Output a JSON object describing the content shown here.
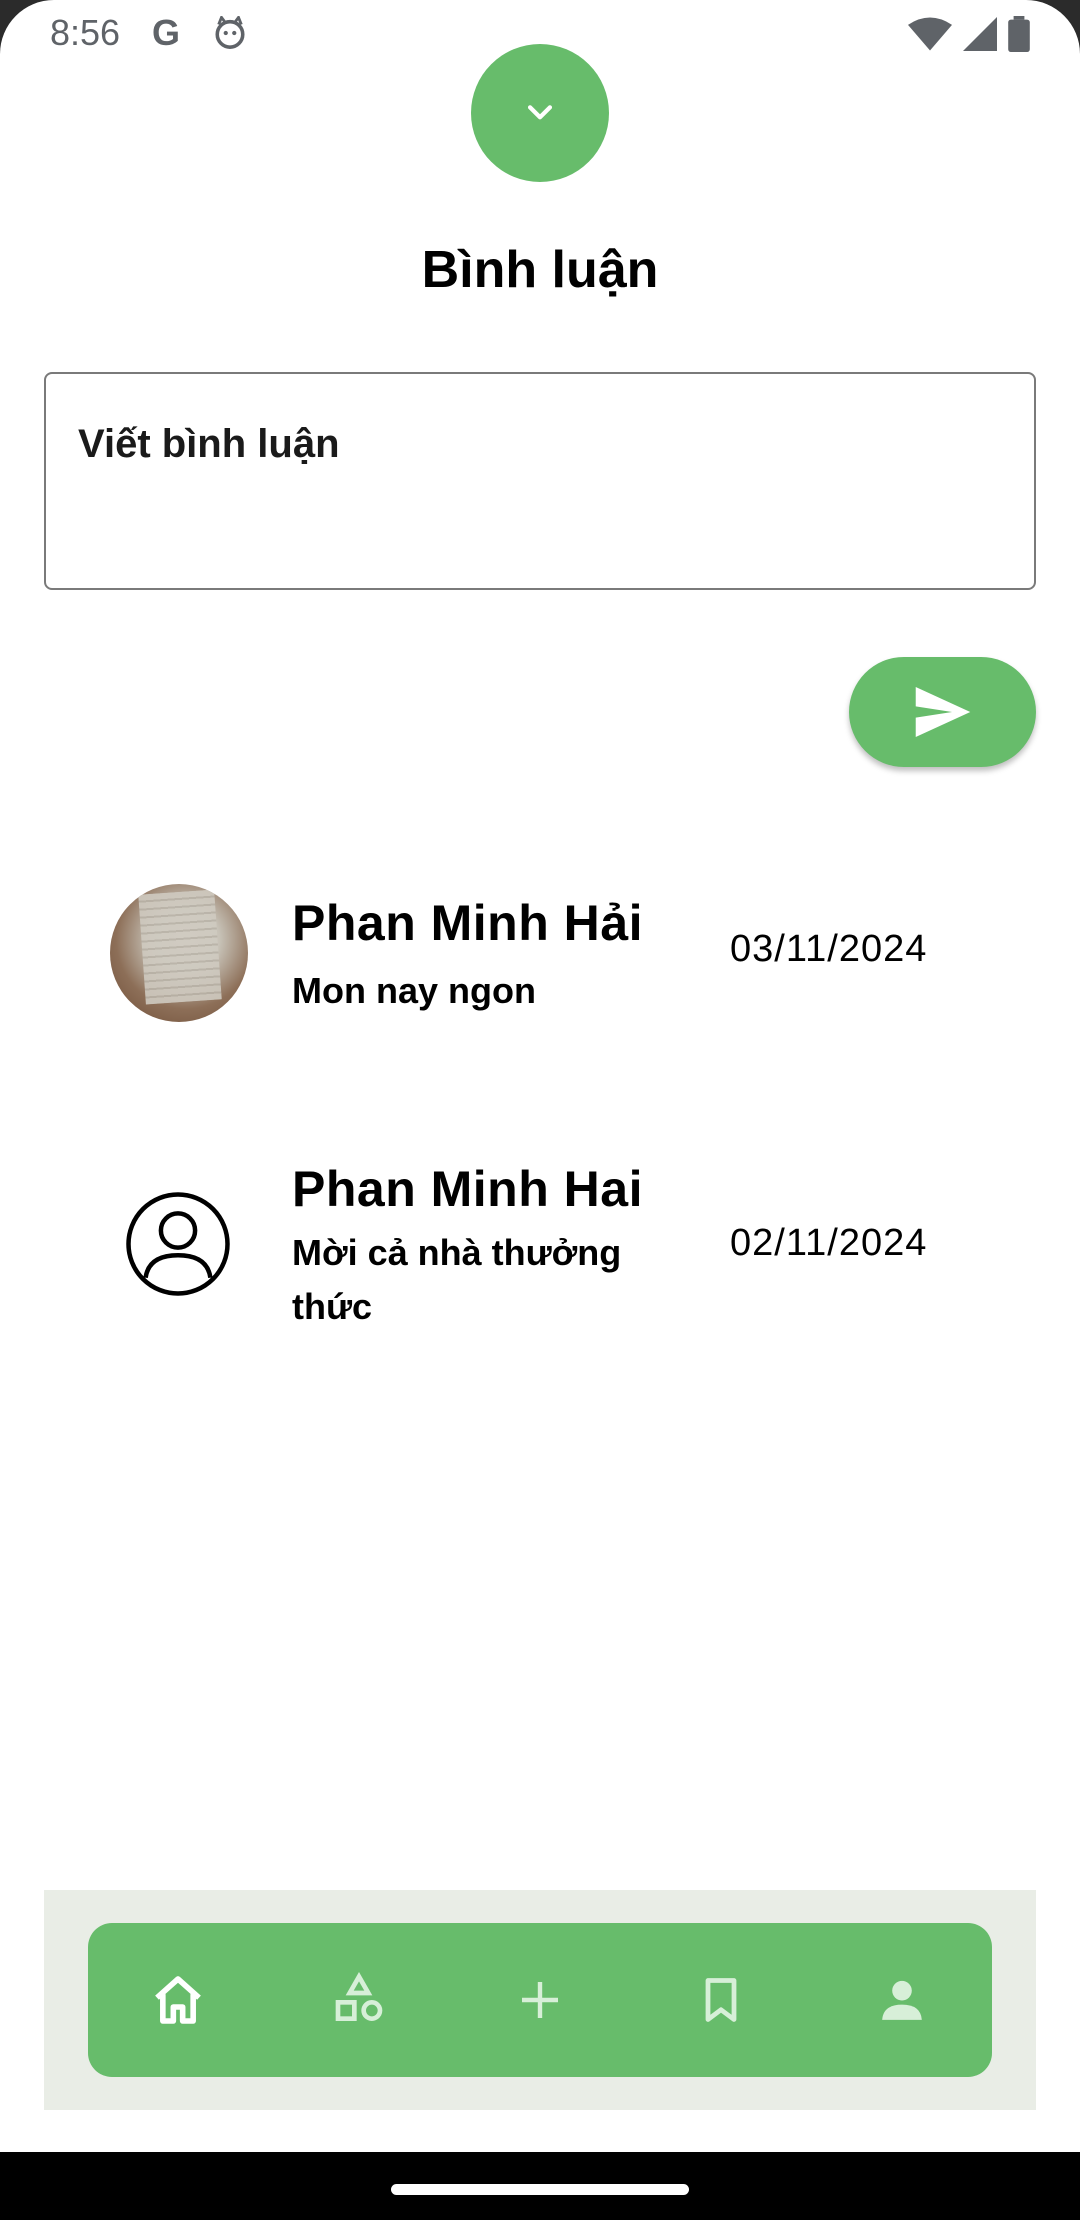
{
  "status_bar": {
    "time": "8:56",
    "google_glyph": "G"
  },
  "header": {
    "dismiss_icon": "chevron-down-icon",
    "title": "Bình luận"
  },
  "composer": {
    "placeholder": "Viết bình luận",
    "send_icon": "send-icon"
  },
  "comments": [
    {
      "name": "Phan Minh Hải",
      "text": "Mon nay ngon",
      "date": "03/11/2024",
      "avatar": "photo"
    },
    {
      "name": "Phan Minh Hai",
      "text": "Mời cả nhà thưởng thức",
      "date": "02/11/2024",
      "avatar": "default-user-icon"
    }
  ],
  "bottom_nav": {
    "items": [
      "home-icon",
      "categories-icon",
      "add-icon",
      "bookmark-icon",
      "profile-icon"
    ],
    "active": "home-icon"
  },
  "colors": {
    "accent": "#67bc6b",
    "nav_background": "#e9ede6",
    "text": "#000000"
  }
}
